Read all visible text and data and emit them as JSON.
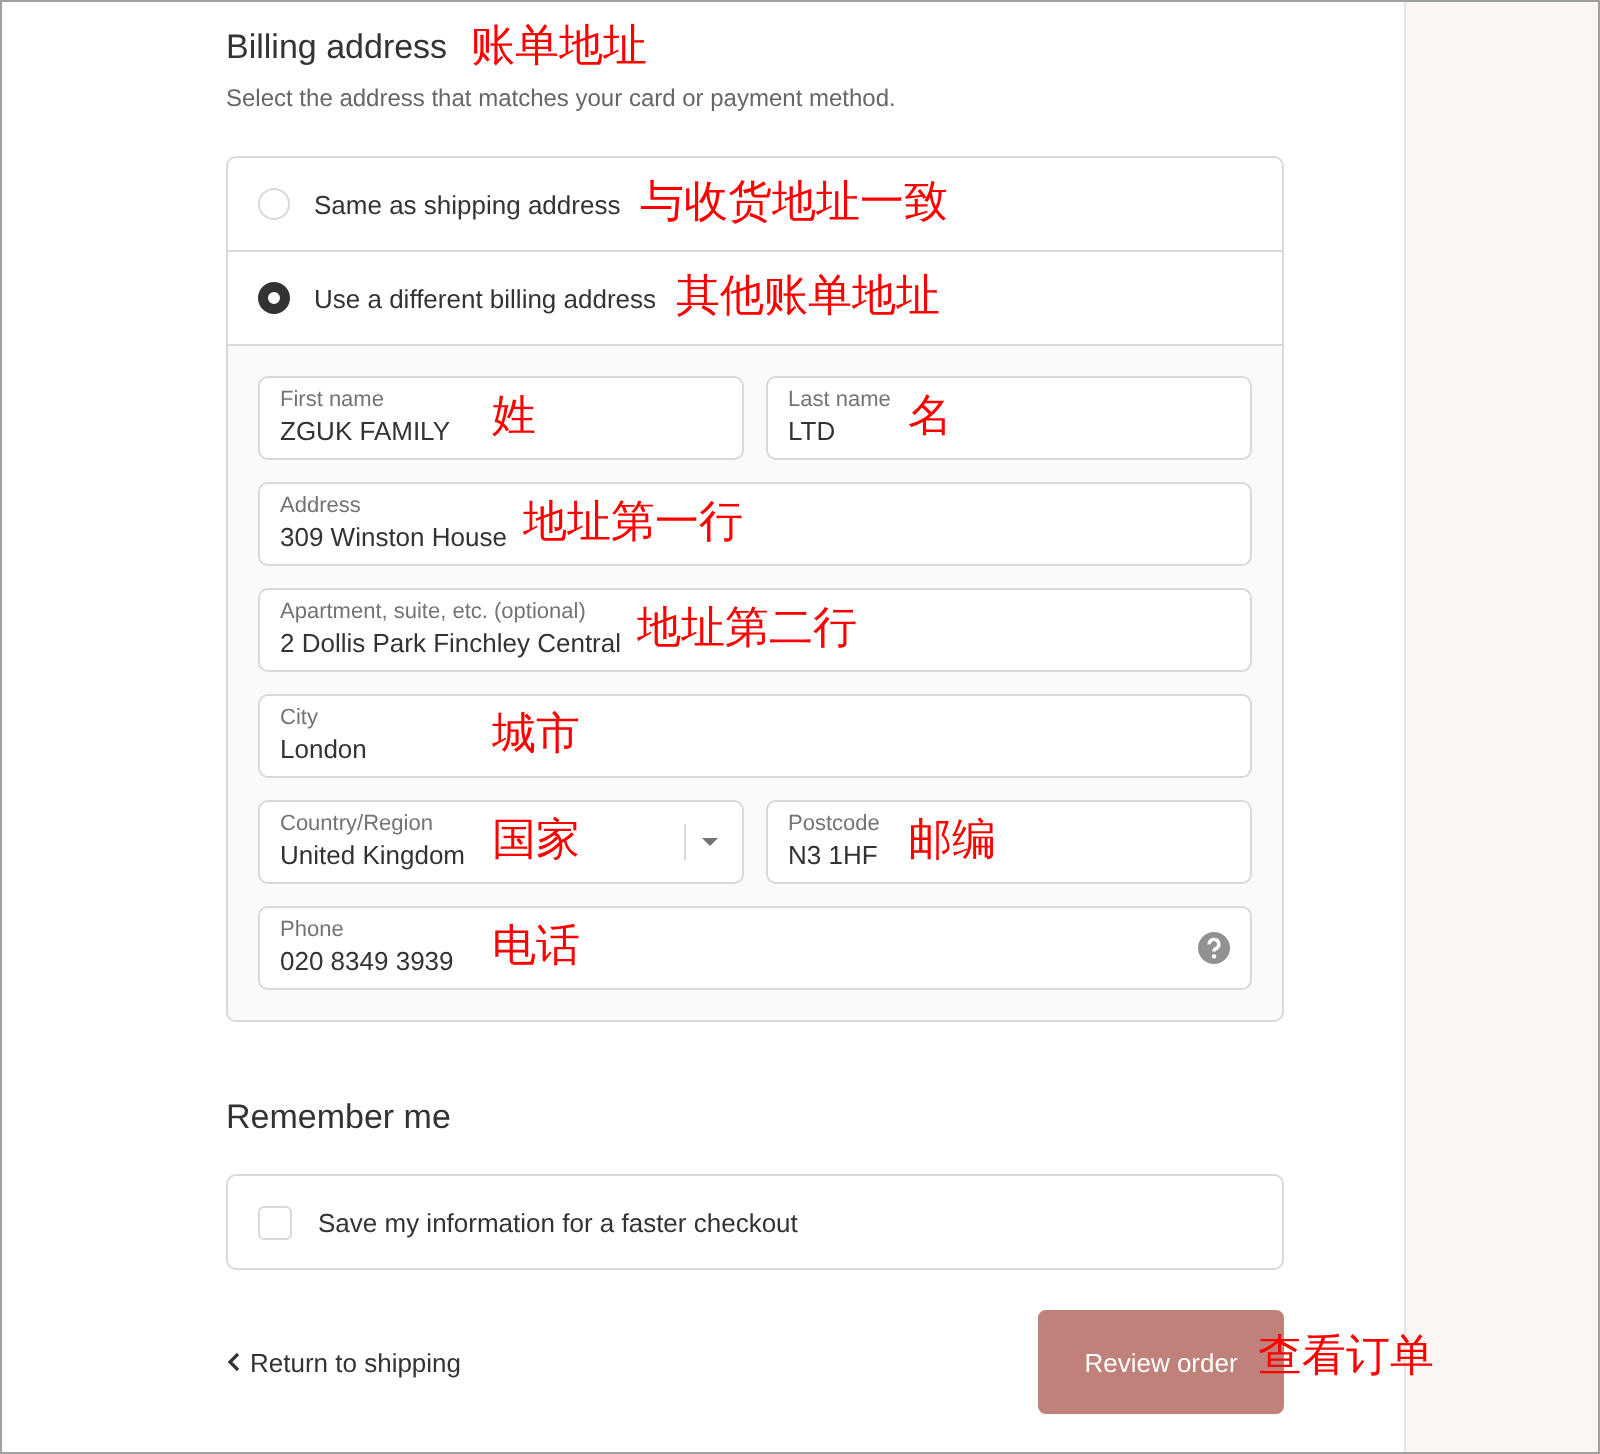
{
  "billing": {
    "title": "Billing address",
    "title_note": "账单地址",
    "subtitle": "Select the address that matches your card or payment method.",
    "options": [
      {
        "label": "Same as shipping address",
        "note": "与收货地址一致",
        "selected": false
      },
      {
        "label": "Use a different billing address",
        "note": "其他账单地址",
        "selected": true
      }
    ],
    "field_rows": [
      [
        {
          "kind": "text",
          "label": "First name",
          "value": "ZGUK FAMILY",
          "note": "姓"
        },
        {
          "kind": "text",
          "label": "Last name",
          "value": "LTD",
          "note": "名"
        }
      ],
      [
        {
          "kind": "text",
          "label": "Address",
          "value": "309 Winston House",
          "note": "地址第一行"
        }
      ],
      [
        {
          "kind": "text",
          "label": "Apartment, suite, etc. (optional)",
          "value": "2 Dollis Park Finchley Central",
          "note": "地址第二行"
        }
      ],
      [
        {
          "kind": "text",
          "label": "City",
          "value": "London",
          "note": "城市"
        }
      ],
      [
        {
          "kind": "select",
          "label": "Country/Region",
          "value": "United Kingdom",
          "note": "国家"
        },
        {
          "kind": "text",
          "label": "Postcode",
          "value": "N3 1HF",
          "note": "邮编"
        }
      ],
      [
        {
          "kind": "phone",
          "label": "Phone",
          "value": "020 8349 3939",
          "note": "电话"
        }
      ]
    ]
  },
  "remember": {
    "title": "Remember me",
    "checkbox": {
      "label": "Save my information for a faster checkout",
      "checked": false
    }
  },
  "footer": {
    "back_link": "Return to shipping",
    "button": "Review order",
    "button_note": "查看订单"
  }
}
